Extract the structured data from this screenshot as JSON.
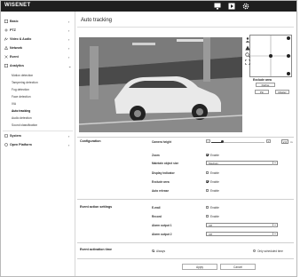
{
  "header": {
    "logo": "WISENET"
  },
  "sidebar": {
    "items": [
      {
        "label": "Basic",
        "icon": "basic-icon"
      },
      {
        "label": "PTZ",
        "icon": "ptz-icon"
      },
      {
        "label": "Video & Audio",
        "icon": "video-audio-icon"
      },
      {
        "label": "Network",
        "icon": "network-icon"
      },
      {
        "label": "Event",
        "icon": "event-icon"
      },
      {
        "label": "Analytics",
        "icon": "analytics-icon"
      }
    ],
    "analytics_sub": [
      "Motion detection",
      "Tampering detection",
      "Fog detection",
      "Face detection",
      "IVA",
      "Auto tracking",
      "Audio detection",
      "Sound classification"
    ],
    "bottom_items": [
      {
        "label": "System",
        "icon": "system-icon"
      },
      {
        "label": "Open Platform",
        "icon": "open-platform-icon"
      }
    ]
  },
  "main": {
    "title": "Auto tracking",
    "exclude_area": {
      "title": "Exclude area",
      "define_label": "Define",
      "buttons": [
        "Pin",
        "Master"
      ]
    },
    "configuration": {
      "title": "Configuration",
      "camera_height_label": "Camera height",
      "camera_height_value": "2.6",
      "camera_height_level": 0.2,
      "camera_height_unit": "m",
      "rows": [
        {
          "label": "Zoom",
          "type": "checkbox",
          "checked": true,
          "text": "Enable"
        },
        {
          "label": "Maintain object size",
          "type": "select",
          "value": "Medium"
        },
        {
          "label": "Display indicator",
          "type": "checkbox",
          "checked": false,
          "text": "Enable"
        },
        {
          "label": "Exclude area",
          "type": "checkbox",
          "checked": true,
          "text": "Enable"
        },
        {
          "label": "Auto release",
          "type": "checkbox",
          "checked": false,
          "text": "Enable"
        }
      ]
    },
    "event_action": {
      "title": "Event action settings",
      "rows": [
        {
          "label": "E-mail",
          "type": "checkbox",
          "checked": false,
          "text": "Enable"
        },
        {
          "label": "Record",
          "type": "checkbox",
          "checked": false,
          "text": "Enable"
        },
        {
          "label": "Alarm output 1",
          "type": "select",
          "value": "Off"
        },
        {
          "label": "Alarm output 2",
          "type": "select",
          "value": "Off"
        }
      ]
    },
    "activation_time": {
      "title": "Event activation time",
      "always_label": "Always",
      "scheduled_label": "Only scheduled time"
    },
    "footer": {
      "apply_label": "Apply",
      "cancel_label": "Cancel"
    }
  }
}
